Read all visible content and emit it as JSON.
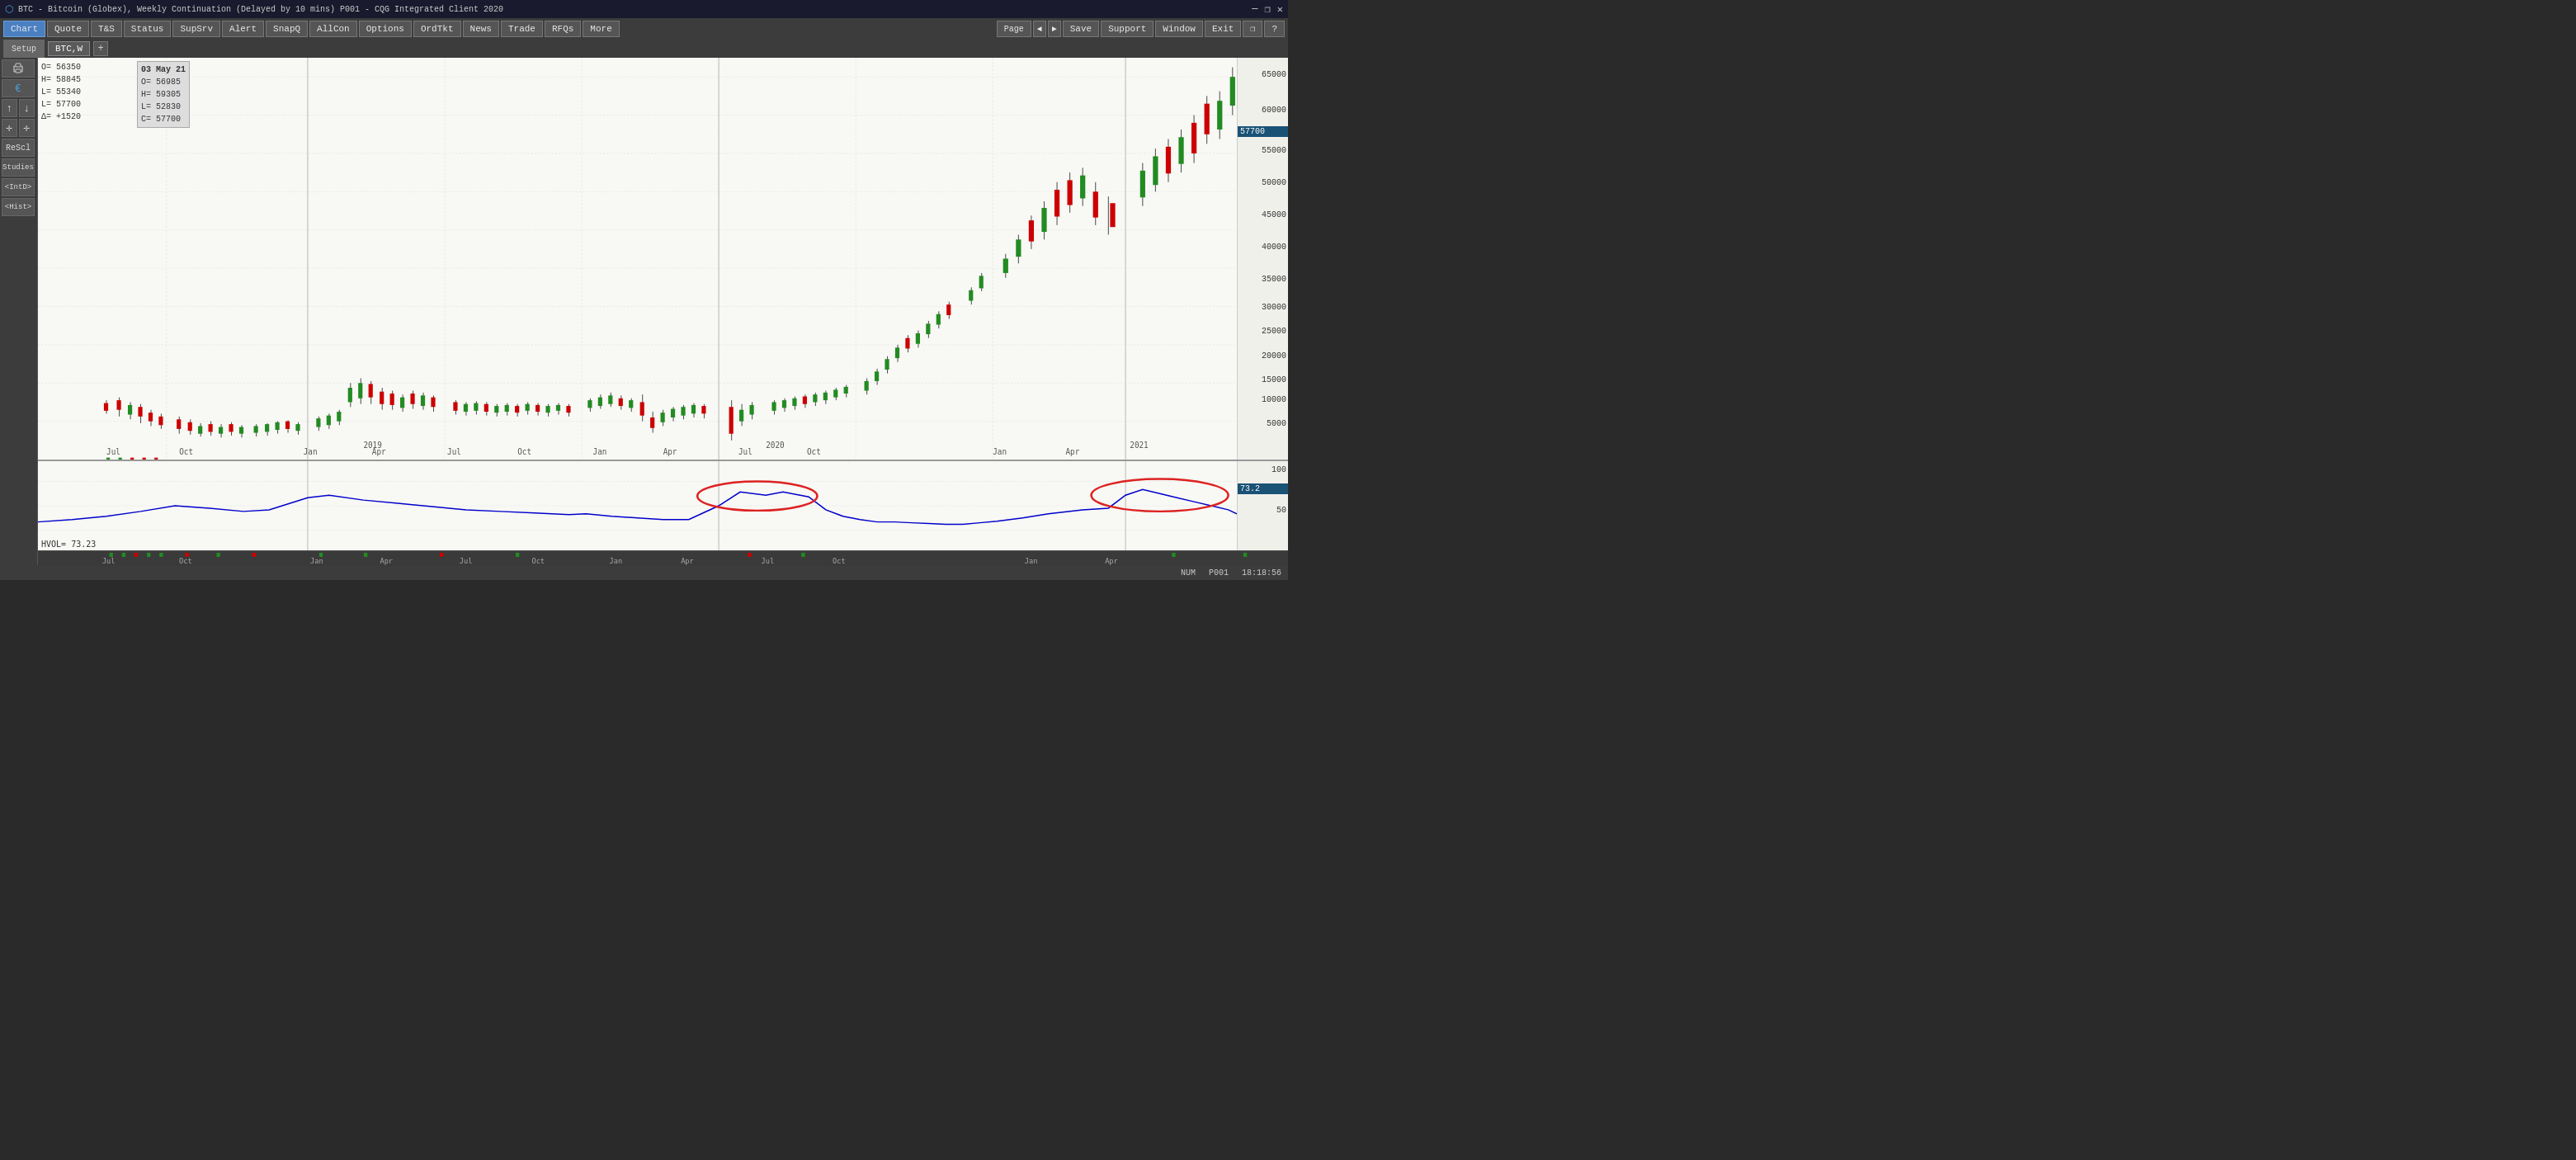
{
  "titleBar": {
    "icon": "⬡",
    "time": "18:18:56",
    "symbol": "BTC - Bitcoin (Globex), Weekly Continuation (Delayed by 10 mins)  P001 - CQG Integrated Client 2020",
    "minimize": "—",
    "restore": "❐",
    "close": "✕"
  },
  "menuBar": {
    "buttons": [
      {
        "id": "chart",
        "label": "Chart",
        "active": true
      },
      {
        "id": "quote",
        "label": "Quote",
        "active": false
      },
      {
        "id": "ts",
        "label": "T&S",
        "active": false
      },
      {
        "id": "status",
        "label": "Status",
        "active": false
      },
      {
        "id": "supsrv",
        "label": "SupSrv",
        "active": false
      },
      {
        "id": "alert",
        "label": "Alert",
        "active": false
      },
      {
        "id": "snapq",
        "label": "SnapQ",
        "active": false
      },
      {
        "id": "allcon",
        "label": "AllCon",
        "active": false
      },
      {
        "id": "options",
        "label": "Options",
        "active": false
      },
      {
        "id": "ordtkt",
        "label": "OrdTkt",
        "active": false
      },
      {
        "id": "news",
        "label": "News",
        "active": false
      },
      {
        "id": "trade",
        "label": "Trade",
        "active": false
      },
      {
        "id": "rfqs",
        "label": "RFQs",
        "active": false
      },
      {
        "id": "more",
        "label": "More",
        "active": false
      }
    ],
    "rightButtons": [
      {
        "id": "page",
        "label": "Page"
      },
      {
        "id": "nav-prev",
        "label": "◄"
      },
      {
        "id": "nav-next",
        "label": "►"
      },
      {
        "id": "save",
        "label": "Save"
      },
      {
        "id": "support",
        "label": "Support"
      },
      {
        "id": "window",
        "label": "Window"
      },
      {
        "id": "exit",
        "label": "Exit"
      },
      {
        "id": "restore2",
        "label": "❐"
      },
      {
        "id": "help",
        "label": "?"
      }
    ]
  },
  "topBar": {
    "setupLabel": "Setup",
    "symbolTab": "BTC,W",
    "addTab": "+"
  },
  "sidebar": {
    "buttons": [
      {
        "id": "print",
        "label": "🖨"
      },
      {
        "id": "euro",
        "label": "€"
      },
      {
        "id": "arrow-up",
        "label": "↑"
      },
      {
        "id": "arrow-down",
        "label": "↓"
      },
      {
        "id": "crosshair1",
        "label": "✛"
      },
      {
        "id": "crosshair2",
        "label": "✛"
      },
      {
        "id": "rescl",
        "label": "ReScl"
      },
      {
        "id": "studies",
        "label": "Studies"
      },
      {
        "id": "intd",
        "label": "<IntD>"
      },
      {
        "id": "hist",
        "label": "<Hist>"
      }
    ]
  },
  "ohlc": {
    "open_label": "O=",
    "open_value": "56350",
    "high_label": "H=",
    "high_value": "58845",
    "low_label": "L=",
    "low_value": "55340",
    "close_label": "L=",
    "close_value": "57700",
    "delta_label": "Δ=",
    "delta_value": "+1520"
  },
  "dateOverlay": {
    "date": "03 May 21",
    "o_label": "O=",
    "o_value": "56985",
    "h_label": "H=",
    "h_value": "59305",
    "l_label": "L=",
    "l_value": "52830",
    "c_label": "C=",
    "c_value": "57700"
  },
  "priceScale": {
    "levels": [
      {
        "price": "65000",
        "pct": 3
      },
      {
        "price": "60000",
        "pct": 12
      },
      {
        "price": "57700",
        "pct": 17,
        "current": true
      },
      {
        "price": "55000",
        "pct": 22
      },
      {
        "price": "50000",
        "pct": 30
      },
      {
        "price": "45000",
        "pct": 38
      },
      {
        "price": "40000",
        "pct": 46
      },
      {
        "price": "35000",
        "pct": 54
      },
      {
        "price": "30000",
        "pct": 61
      },
      {
        "price": "25000",
        "pct": 67
      },
      {
        "price": "20000",
        "pct": 73
      },
      {
        "price": "15000",
        "pct": 79
      },
      {
        "price": "10000",
        "pct": 84
      },
      {
        "price": "5000",
        "pct": 90
      }
    ]
  },
  "xAxisLabels": [
    "Jul",
    "Oct",
    "Jan",
    "Apr",
    "Jul",
    "Oct",
    "Jan",
    "Apr",
    "Jul",
    "Oct",
    "Jan",
    "Apr"
  ],
  "yearLabels": [
    {
      "label": "2019",
      "pct": 22
    },
    {
      "label": "2020",
      "pct": 53
    },
    {
      "label": "2021",
      "pct": 83
    }
  ],
  "hvolSection": {
    "label": "HVol",
    "hvol_label": "HVOL=",
    "hvol_value": "73.23",
    "scaleLabels": [
      "100",
      "50"
    ],
    "currentValue": "73.2"
  },
  "bottomBar": {
    "num": "NUM",
    "p001": "P001",
    "time": "18:18:56"
  }
}
